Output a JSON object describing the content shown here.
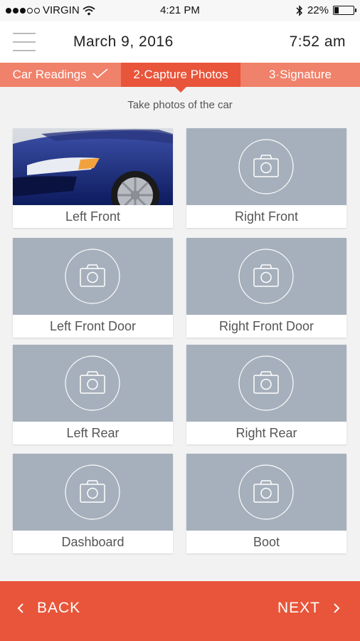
{
  "status_bar": {
    "carrier": "VIRGIN",
    "time": "4:21 PM",
    "battery": "22%",
    "battery_level": 0.22,
    "signal_dots_filled": 3,
    "signal_dots_total": 5,
    "icons": [
      "wifi-icon",
      "bluetooth-icon",
      "battery-icon"
    ]
  },
  "header": {
    "date": "March 9,  2016",
    "time": "7:52 am"
  },
  "steps": [
    {
      "label": "Car Readings",
      "state": "done"
    },
    {
      "label": "2·Capture Photos",
      "state": "active"
    },
    {
      "label": "3·Signature",
      "state": "pending"
    }
  ],
  "instruction": "Take photos of the car",
  "photos": [
    {
      "label": "Left Front",
      "captured": true
    },
    {
      "label": "Right Front",
      "captured": false
    },
    {
      "label": "Left Front Door",
      "captured": false
    },
    {
      "label": "Right Front Door",
      "captured": false
    },
    {
      "label": "Left Rear",
      "captured": false
    },
    {
      "label": "Right Rear",
      "captured": false
    },
    {
      "label": "Dashboard",
      "captured": false
    },
    {
      "label": "Boot",
      "captured": false
    }
  ],
  "footer": {
    "back_label": "BACK",
    "next_label": "NEXT"
  },
  "colors": {
    "accent": "#e8553a",
    "step_bar": "#f0816a",
    "placeholder": "#a6b0bc"
  }
}
